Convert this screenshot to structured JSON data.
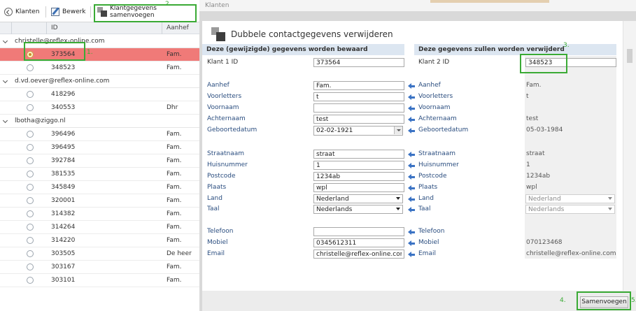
{
  "toolbar": {
    "back_label": "Klanten",
    "edit_label": "Bewerk",
    "merge_label": "Klantgegevens samenvoegen"
  },
  "grid": {
    "col_id": "ID",
    "col_aanhef": "Aanhef",
    "groups": [
      {
        "email": "christelle@reflex-online.com",
        "rows": [
          {
            "id": "373564",
            "aanhef": "Fam.",
            "selected": true
          },
          {
            "id": "348523",
            "aanhef": "Fam.",
            "selected": false
          }
        ]
      },
      {
        "email": "d.vd.oever@reflex-online.com",
        "rows": [
          {
            "id": "418296",
            "aanhef": "",
            "selected": false
          },
          {
            "id": "340553",
            "aanhef": "Dhr",
            "selected": false
          }
        ]
      },
      {
        "email": "lbotha@ziggo.nl",
        "rows": [
          {
            "id": "396496",
            "aanhef": "Fam.",
            "selected": false
          },
          {
            "id": "396495",
            "aanhef": "Fam.",
            "selected": false
          },
          {
            "id": "392784",
            "aanhef": "Fam.",
            "selected": false
          },
          {
            "id": "381535",
            "aanhef": "Fam.",
            "selected": false
          },
          {
            "id": "345849",
            "aanhef": "Fam.",
            "selected": false
          },
          {
            "id": "320001",
            "aanhef": "Fam.",
            "selected": false
          },
          {
            "id": "314382",
            "aanhef": "Fam.",
            "selected": false
          },
          {
            "id": "314264",
            "aanhef": "Fam.",
            "selected": false
          },
          {
            "id": "314220",
            "aanhef": "Fam.",
            "selected": false
          },
          {
            "id": "303505",
            "aanhef": "De heer",
            "selected": false
          },
          {
            "id": "303167",
            "aanhef": "Fam.",
            "selected": false
          },
          {
            "id": "303101",
            "aanhef": "Fam.",
            "selected": false
          }
        ]
      }
    ]
  },
  "overlay_tab": "Klanten",
  "annotations": {
    "n1": "1.",
    "n2": "2.",
    "n3": "3.",
    "n4": "4.",
    "n5": "5."
  },
  "modal": {
    "title": "Dubbele contactgegevens verwijderen",
    "keep_header": "Deze (gewijzigde) gegevens worden bewaard",
    "remove_header": "Deze gegevens zullen worden verwijderd",
    "k1_label": "Klant 1 ID",
    "k1_value": "373564",
    "k2_label": "Klant 2 ID",
    "k2_value": "348523",
    "fields": {
      "aanhef": {
        "label": "Aanhef",
        "keep": "Fam.",
        "remove": "Fam."
      },
      "voorletters": {
        "label": "Voorletters",
        "keep": "t",
        "remove": "t"
      },
      "voornaam": {
        "label": "Voornaam",
        "keep": "",
        "remove": ""
      },
      "achternaam": {
        "label": "Achternaam",
        "keep": "test",
        "remove": "test"
      },
      "geboortedatum": {
        "label": "Geboortedatum",
        "keep": "02-02-1921",
        "remove": "05-03-1984"
      },
      "straatnaam": {
        "label": "Straatnaam",
        "keep": "straat",
        "remove": "straat"
      },
      "huisnummer": {
        "label": "Huisnummer",
        "keep": "1",
        "remove": "1"
      },
      "postcode": {
        "label": "Postcode",
        "keep": "1234ab",
        "remove": "1234ab"
      },
      "plaats": {
        "label": "Plaats",
        "keep": "wpl",
        "remove": "wpl"
      },
      "land": {
        "label": "Land",
        "keep": "Nederland",
        "remove": "Nederland"
      },
      "taal": {
        "label": "Taal",
        "keep": "Nederlands",
        "remove": "Nederlands"
      },
      "telefoon": {
        "label": "Telefoon",
        "keep": "",
        "remove": ""
      },
      "mobiel": {
        "label": "Mobiel",
        "keep": "0345612311",
        "remove": "070123468"
      },
      "email": {
        "label": "Email",
        "keep": "christelle@reflex-online.com",
        "remove": "christelle@reflex-online.com"
      }
    },
    "merge_button": "Samenvoegen"
  },
  "colors": {
    "selected_row": "#f07a78",
    "annotation_green": "#3aaa35",
    "arrow_blue": "#3b73c4",
    "section_header": "#dce6f1"
  }
}
